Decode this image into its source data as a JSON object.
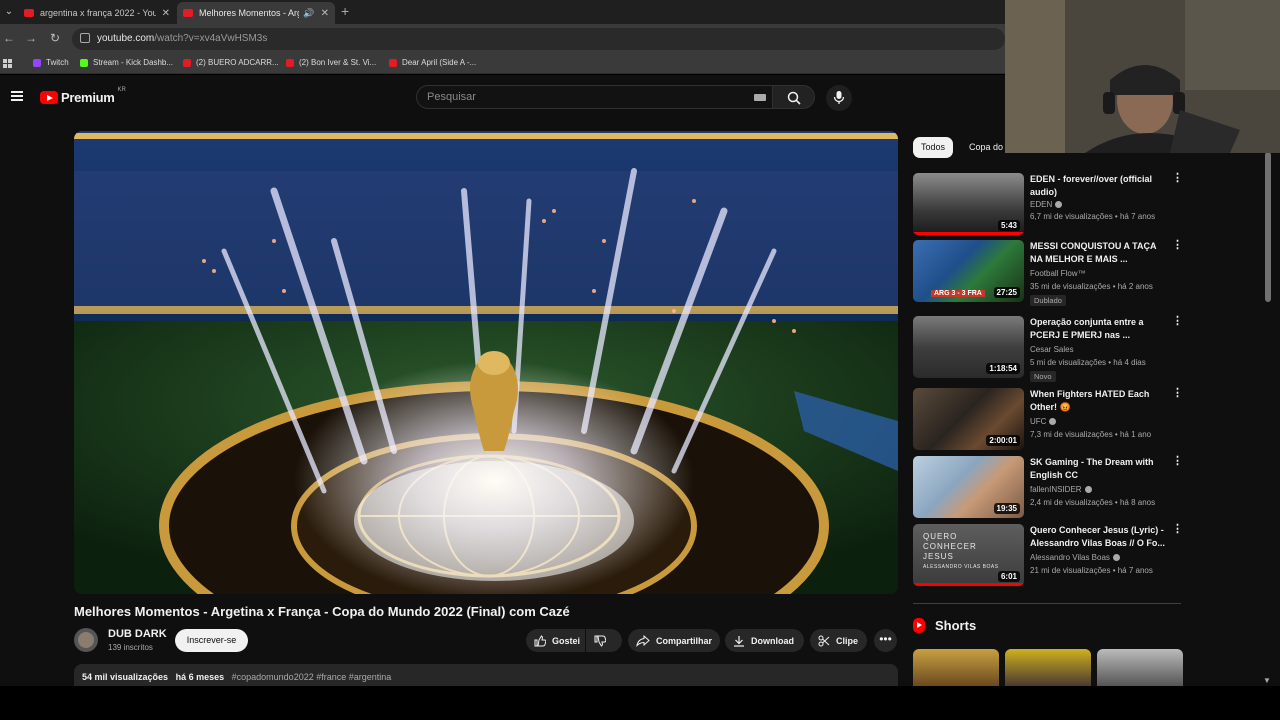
{
  "browser": {
    "tabs": [
      {
        "title": "argentina x frança 2022 - YouTu",
        "close": "✕"
      },
      {
        "title": "Melhores Momentos - Arge",
        "close": "✕"
      }
    ],
    "new_tab": "+",
    "url_domain": "youtube.com",
    "url_path": "/watch?v=xv4aVwHSM3s",
    "bookmarks": [
      {
        "label": "Twitch",
        "color": "#9146ff"
      },
      {
        "label": "Stream - Kick Dashb...",
        "color": "#53fc18"
      },
      {
        "label": "(2) BUERO ADCARR...",
        "color": "#e31b23"
      },
      {
        "label": "(2) Bon Iver & St. Vi...",
        "color": "#e31b23"
      },
      {
        "label": "Dear April (Side A -...",
        "color": "#e31b23"
      }
    ]
  },
  "youtube": {
    "logo_text": "Premium",
    "country_code": "KR",
    "search_placeholder": "Pesquisar",
    "video": {
      "title": "Melhores Momentos - Argetina x França - Copa do Mundo 2022 (Final) com Cazé",
      "channel": "DUB DARK",
      "subscribers": "139 inscritos",
      "subscribe_label": "Inscrever-se",
      "like_label": "Gostei",
      "share_label": "Compartilhar",
      "download_label": "Download",
      "clip_label": "Clipe",
      "more": "•••",
      "views": "54 mil visualizações",
      "age": "há 6 meses",
      "tags": "#copadomundo2022 #france #argentina"
    },
    "chips": [
      "Todos",
      "Copa do"
    ],
    "recommendations": [
      {
        "title": "EDEN - forever//over (official audio)",
        "channel": "EDEN",
        "verified": true,
        "meta": "6,7 mi de visualizações • há 7 anos",
        "duration": "5:43",
        "badge": "",
        "progress": 1.0
      },
      {
        "title": "MESSI CONQUISTOU A TAÇA NA MELHOR E MAIS ...",
        "channel": "Football Flow™",
        "verified": false,
        "meta": "35 mi de visualizações • há 2 anos",
        "duration": "27:25",
        "badge": "Dublado",
        "progress": 0.0
      },
      {
        "title": "Operação conjunta entre a PCERJ E PMERJ nas ...",
        "channel": "Cesar Sales",
        "verified": false,
        "meta": "5 mi de visualizações • há 4 dias",
        "duration": "1:18:54",
        "badge": "Novo",
        "progress": 0.0
      },
      {
        "title": "When Fighters HATED Each Other! 😡",
        "channel": "UFC",
        "verified": true,
        "meta": "7,3 mi de visualizações • há 1 ano",
        "duration": "2:00:01",
        "badge": "",
        "progress": 0.0
      },
      {
        "title": "SK Gaming - The Dream with English CC",
        "channel": "fallenINSIDER",
        "verified": true,
        "meta": "2,4 mi de visualizações • há 8 anos",
        "duration": "19:35",
        "badge": "",
        "progress": 0.0
      },
      {
        "title": "Quero Conhecer Jesus (Lyric) - Alessandro Vilas Boas // O Fo...",
        "channel": "Alessandro Vilas Boas",
        "verified": true,
        "meta": "21 mi de visualizações • há 7 anos",
        "duration": "6:01",
        "badge": "",
        "progress": 1.0
      }
    ],
    "shorts_title": "Shorts",
    "thumbnail_text": {
      "score": "ARG 3 - 3 FRA",
      "jesus_line1": "QUERO",
      "jesus_line2": "CONHECER",
      "jesus_line3": "JESUS",
      "jesus_line4": "ALESSANDRO VILAS BOAS"
    }
  }
}
